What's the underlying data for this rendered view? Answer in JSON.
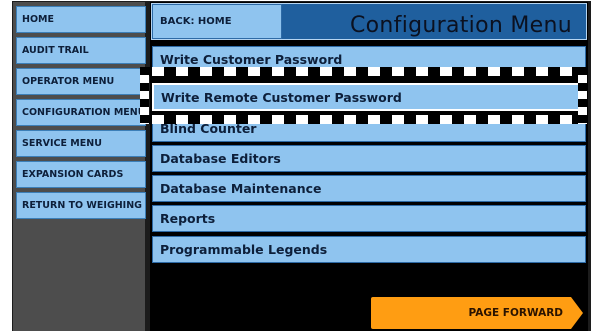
{
  "nav": {
    "items": [
      {
        "label": "HOME"
      },
      {
        "label": "AUDIT TRAIL"
      },
      {
        "label": "OPERATOR MENU"
      },
      {
        "label": "CONFIGURATION MENU"
      },
      {
        "label": "SERVICE MENU"
      },
      {
        "label": "EXPANSION CARDS"
      },
      {
        "label": "RETURN TO WEIGHING"
      }
    ]
  },
  "header": {
    "back_label": "BACK: HOME",
    "title": "Configuration Menu"
  },
  "menu": {
    "selected_index": 1,
    "items": [
      {
        "label": "Write Customer Password"
      },
      {
        "label": "Write Remote Customer Password"
      },
      {
        "label": "Blind Counter"
      },
      {
        "label": "Database Editors"
      },
      {
        "label": "Database Maintenance"
      },
      {
        "label": "Reports"
      },
      {
        "label": "Programmable Legends"
      }
    ]
  },
  "footer": {
    "page_forward_label": "PAGE FORWARD"
  },
  "colors": {
    "button_fill": "#8fc4ef",
    "header_fill": "#1f5f9e",
    "accent_orange": "#ff9d12"
  }
}
